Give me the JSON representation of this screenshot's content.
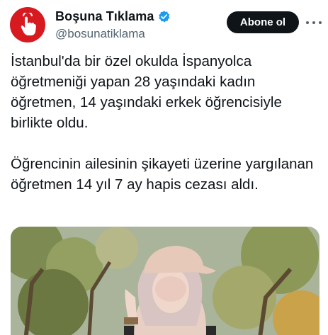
{
  "author": {
    "display_name": "Boşuna Tıklama",
    "handle": "@bosunatiklama",
    "avatar_icon": "hand-click-icon",
    "verified_icon": "verified-badge-icon",
    "avatar_color": "#d71920",
    "verified_color": "#1d9bf0"
  },
  "actions": {
    "follow_label": "Abone ol",
    "more_icon": "more-options-icon"
  },
  "tweet": {
    "paragraph1": "İstanbul'da bir özel okulda İspanyolca öğretmeniği yapan 28 yaşındaki kadın öğretmen, 14 yaşındaki erkek öğrencisiyle birlikte oldu.",
    "paragraph2": "Öğrencinin ailesinin şikayeti üzerine yargılanan öğretmen 14 yıl 7 ay hapis cezası aldı."
  }
}
